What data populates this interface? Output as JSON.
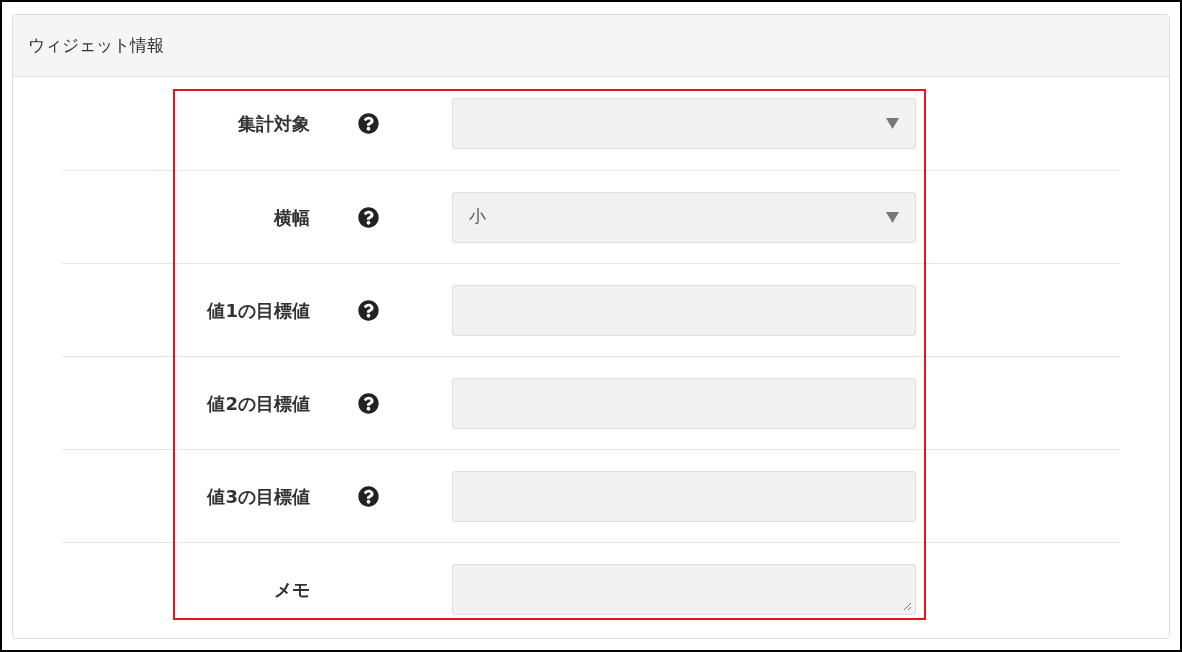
{
  "panel": {
    "title": "ウィジェット情報"
  },
  "fields": [
    {
      "kind": "select",
      "label": "集計対象",
      "help": true
    },
    {
      "kind": "select",
      "label": "横幅",
      "help": true,
      "value": "小"
    },
    {
      "kind": "text",
      "label": "値1の目標値",
      "help": true
    },
    {
      "kind": "text",
      "label": "値2の目標値",
      "help": true
    },
    {
      "kind": "text",
      "label": "値3の目標値",
      "help": true
    },
    {
      "kind": "textarea",
      "label": "メモ",
      "help": false
    }
  ],
  "highlight": {
    "shown": true
  }
}
